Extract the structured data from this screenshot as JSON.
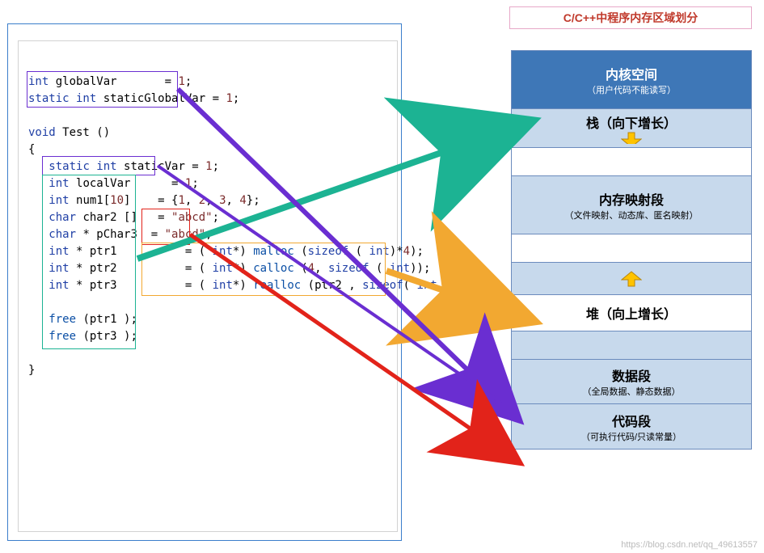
{
  "title": "C/C++中程序内存区域划分",
  "code": {
    "l1": "int globalVar       = 1;",
    "l2": "static int staticGlobalVar = 1;",
    "l3": "",
    "l4": "void Test ()",
    "l5": "{",
    "l6": "   static int staticVar = 1;",
    "l7": "   int localVar      = 1;",
    "l8": "   int num1[10]    = {1, 2, 3, 4};",
    "l9": "   char char2 []   = \"abcd\";",
    "l10": "   char * pChar3  = \"abcd\";",
    "l11": "   int * ptr1          = ( int*) malloc (sizeof ( int)*4);",
    "l12": "   int * ptr2          = ( int*) calloc (4, sizeof ( int));",
    "l13": "   int * ptr3          = ( int*) realloc (ptr2 , sizeof( int )*4);",
    "l14": "",
    "l15": "   free (ptr1 );",
    "l16": "   free (ptr3 );",
    "l17": "",
    "l18": "}"
  },
  "mem": {
    "kernel_big": "内核空间",
    "kernel_small": "（用户代码不能读写）",
    "stack_label": "栈（向下增长）",
    "mmap_big": "内存映射段",
    "mmap_small": "（文件映射、动态库、匿名映射）",
    "heap_label": "堆（向上增长）",
    "data_big": "数据段",
    "data_small": "（全局数据、静态数据）",
    "code_big": "代码段",
    "code_small": "（可执行代码/只读常量）"
  },
  "arrows": {
    "stack_color": "#1cb393",
    "heap_color": "#f2a831",
    "data_color": "#6a2ed1",
    "code_color": "#e2231a",
    "down_arrow_color": "#ffc300",
    "up_arrow_color": "#ffc300"
  },
  "boxes": {
    "purple": "#6a2ed1",
    "teal": "#1cb393",
    "red": "#e2231a",
    "orange": "#f2a831"
  },
  "watermark": "https://blog.csdn.net/qq_49613557"
}
